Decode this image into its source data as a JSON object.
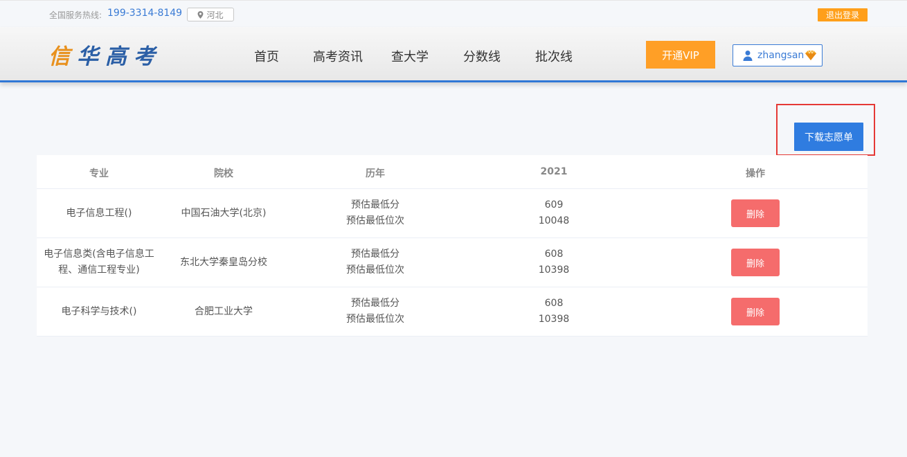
{
  "topbar": {
    "hotline_label": "全国服务热线:",
    "hotline_number": "199-3314-8149",
    "region": "河北",
    "logout": "退出登录"
  },
  "header": {
    "logo": {
      "part1": "信",
      "part2": "华",
      "part3": "高",
      "part4": "考"
    },
    "nav": [
      "首页",
      "高考资讯",
      "查大学",
      "分数线",
      "批次线"
    ],
    "vip": "开通VIP",
    "username": "zhangsan"
  },
  "actions": {
    "download": "下载志愿单"
  },
  "table": {
    "headers": [
      "专业",
      "院校",
      "历年",
      "2021",
      "操作"
    ],
    "rows": [
      {
        "major": "电子信息工程()",
        "school": "中国石油大学(北京)",
        "label1": "预估最低分",
        "label2": "预估最低位次",
        "score": "609",
        "rank": "10048",
        "action": "删除"
      },
      {
        "major": "电子信息类(含电子信息工程、通信工程专业)",
        "school": "东北大学秦皇岛分校",
        "label1": "预估最低分",
        "label2": "预估最低位次",
        "score": "608",
        "rank": "10398",
        "action": "删除"
      },
      {
        "major": "电子科学与技术()",
        "school": "合肥工业大学",
        "label1": "预估最低分",
        "label2": "预估最低位次",
        "score": "608",
        "rank": "10398",
        "action": "删除"
      }
    ]
  },
  "colors": {
    "primary": "#2f7ce0",
    "orange": "#ff9f26",
    "danger": "#f56c6c",
    "highlight_border": "#e53935"
  },
  "icons": {
    "region": "location-pin-icon",
    "user": "user-icon",
    "vip_badge": "diamond-icon"
  }
}
